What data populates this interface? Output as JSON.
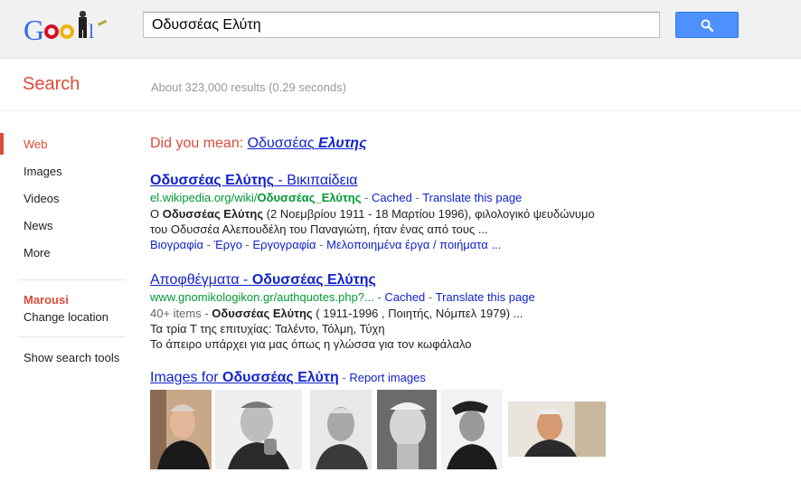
{
  "search": {
    "query": "Οδυσσέας Ελύτη",
    "button_icon": "search-icon"
  },
  "subheader": {
    "label": "Search",
    "stats": "About 323,000 results (0.29 seconds)"
  },
  "nav": {
    "items": [
      "Web",
      "Images",
      "Videos",
      "News",
      "More"
    ],
    "location": "Marousi",
    "change_location": "Change location",
    "tools": "Show search tools"
  },
  "did_you_mean": {
    "prefix": "Did you mean:",
    "plain": "Οδυσσέας",
    "emph": "Ελυτης"
  },
  "results": [
    {
      "title_bold": "Οδυσσέας Ελύτης",
      "title_rest": " - Βικιπαίδεια",
      "url_pre": "el.wikipedia.org/wiki/",
      "url_bold": "Οδυσσέας_Ελύτης",
      "cached": "Cached",
      "translate": "Translate this page",
      "snippet1_pre": "Ο ",
      "snippet1_bold": "Οδυσσέας Ελύτης",
      "snippet1_rest": " (2 Νοεμβρίου 1911 - 18 Μαρτίου 1996), φιλολογικό ψευδώνυμο",
      "snippet2": "του Οδυσσέα Αλεπουδέλη του Παναγιώτη, ήταν ένας από τους ...",
      "sitelinks": [
        "Βιογραφία",
        "Έργο",
        "Εργογραφία",
        "Μελοποιημένα έργα / ποιήματα ..."
      ]
    },
    {
      "title_pre": "Αποφθέγματα - ",
      "title_bold": "Οδυσσέας Ελύτης",
      "url": "www.gnomikologikon.gr/authquotes.php?...",
      "cached": "Cached",
      "translate": "Translate this page",
      "meta_count": "40+ items",
      "meta_bold": "Οδυσσέας Ελύτης",
      "meta_rest": " ( 1911-1996 , Ποιητής, Νόμπελ 1979) ...",
      "line1": "Τα τρία Τ της επιτυχίας: Ταλέντο, Τόλμη, Τύχη",
      "line2": "Το άπειρο υπάρχει για μας όπως η γλώσσα για τον κωφάλαλο"
    }
  ],
  "images": {
    "prefix": "Images for ",
    "bold": "Οδυσσέας Ελύτη",
    "report": "Report images",
    "thumbs": [
      "thumb-1",
      "thumb-2",
      "thumb-3",
      "thumb-4",
      "thumb-5",
      "thumb-6"
    ]
  },
  "colors": {
    "accent_red": "#dd4b39",
    "link_blue": "#1122cc",
    "url_green": "#009933",
    "button_blue": "#4d90fe"
  }
}
